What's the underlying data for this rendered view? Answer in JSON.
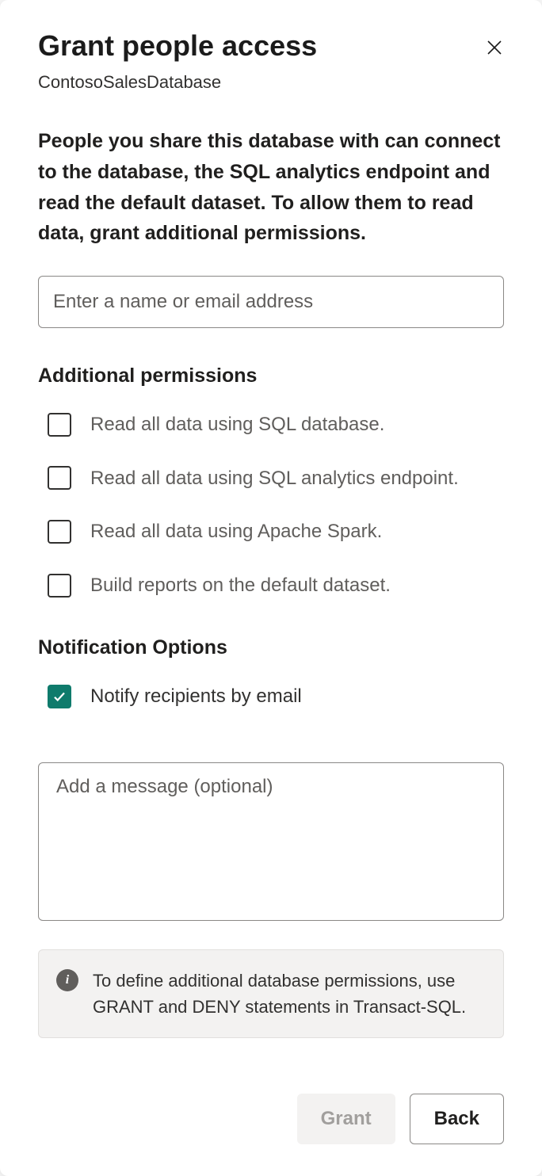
{
  "dialog": {
    "title": "Grant people access",
    "subtitle": "ContosoSalesDatabase",
    "description": "People you share this database with can connect to the database, the SQL analytics endpoint and read the default dataset. To allow them to read data, grant additional permissions.",
    "name_placeholder": "Enter a name or email address"
  },
  "permissions": {
    "section_title": "Additional permissions",
    "items": [
      {
        "label": "Read all data using SQL database.",
        "checked": false
      },
      {
        "label": "Read all data using SQL analytics endpoint.",
        "checked": false
      },
      {
        "label": "Read all data using Apache Spark.",
        "checked": false
      },
      {
        "label": "Build reports on the default dataset.",
        "checked": false
      }
    ]
  },
  "notification": {
    "section_title": "Notification Options",
    "notify_label": "Notify recipients by email",
    "notify_checked": true,
    "message_placeholder": "Add a message (optional)"
  },
  "info": {
    "text": "To define additional database permissions, use GRANT and DENY statements in Transact-SQL."
  },
  "footer": {
    "grant_label": "Grant",
    "back_label": "Back"
  }
}
